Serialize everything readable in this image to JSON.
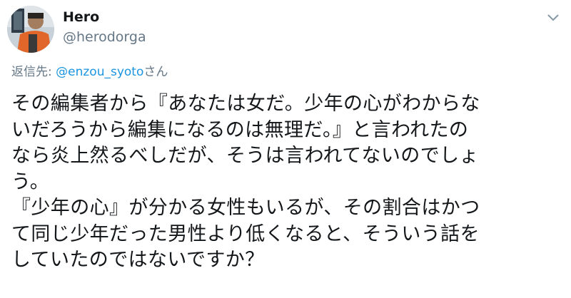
{
  "tweet": {
    "display_name": "Hero",
    "handle": "@herodorga",
    "reply_prefix": "返信先: ",
    "reply_mention": "@enzou_syoto",
    "reply_suffix": "さん",
    "body_lines": [
      "その編集者から『あなたは女だ。少年の心がわからな",
      "いだろうから編集になるのは無理だ。』と言われたの",
      "なら炎上然るべしだが、そうは言われてないのでしょ",
      "う。",
      "『少年の心』が分かる女性もいるが、その割合はかつ",
      "て同じ少年だった男性より低くなると、そういう話を",
      "していたのではないですか？"
    ]
  },
  "icons": {
    "caret": "chevron-down-icon"
  },
  "colors": {
    "text": "#14171a",
    "secondary": "#657786",
    "link": "#1b95e0",
    "background": "#ffffff"
  }
}
